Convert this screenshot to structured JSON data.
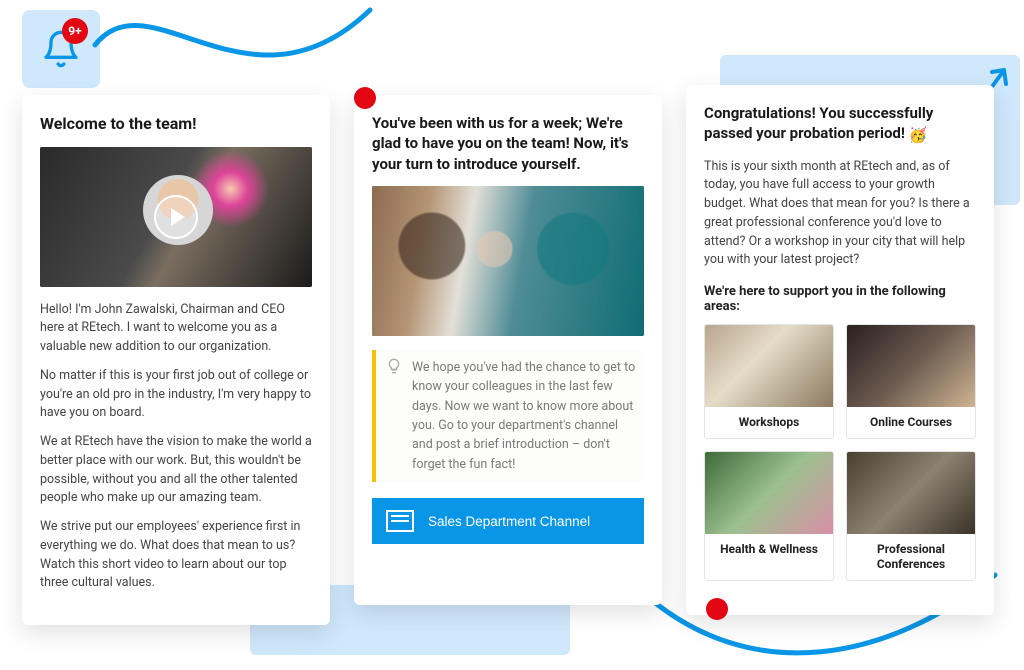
{
  "notification": {
    "badge": "9+"
  },
  "cards": {
    "welcome": {
      "title": "Welcome to the team!",
      "p1": "Hello! I'm John Zawalski, Chairman and CEO here at REtech. I want to welcome you as a valuable new addition to our organization.",
      "p2": "No matter if this is your first job out of college or you're an old pro in the industry, I'm very happy to have you on board.",
      "p3": "We at REtech have the vision to make the world a better place with our work. But, this wouldn't be possible, without you and all the other talented people who make up our amazing team.",
      "p4": "We strive put our employees' experience first in everything we do. What does that mean to us? Watch this short video to learn about our top three cultural values."
    },
    "week": {
      "title": "You've been with us for a week; We're glad to have you on the team! Now, it's your turn to introduce yourself.",
      "tip": "We hope you've had the chance to get to know your colleagues in the last few days. Now we want to know more about you. Go to your department's channel and post a brief introduction – don't forget the fun fact!",
      "button_label": "Sales Department Channel"
    },
    "probation": {
      "title_part1": "Congratulations! You successfully passed your probation period! ",
      "emoji": "🥳",
      "intro": "This is your sixth month at REtech and, as of today, you have full access to your growth budget. What does that mean for you? Is there a great professional conference you'd love to attend? Or a workshop in your city that will help you with your latest project?",
      "subhead": "We're here to support you in the following areas:",
      "tiles": {
        "t1": "Workshops",
        "t2": "Online Courses",
        "t3": "Health & Wellness",
        "t4": "Professional Conferences"
      }
    }
  },
  "colors": {
    "accent_blue": "#0a96e6",
    "badge_red": "#e30613",
    "tip_yellow": "#f5c400",
    "bg_light_blue": "#cfe8fb"
  }
}
